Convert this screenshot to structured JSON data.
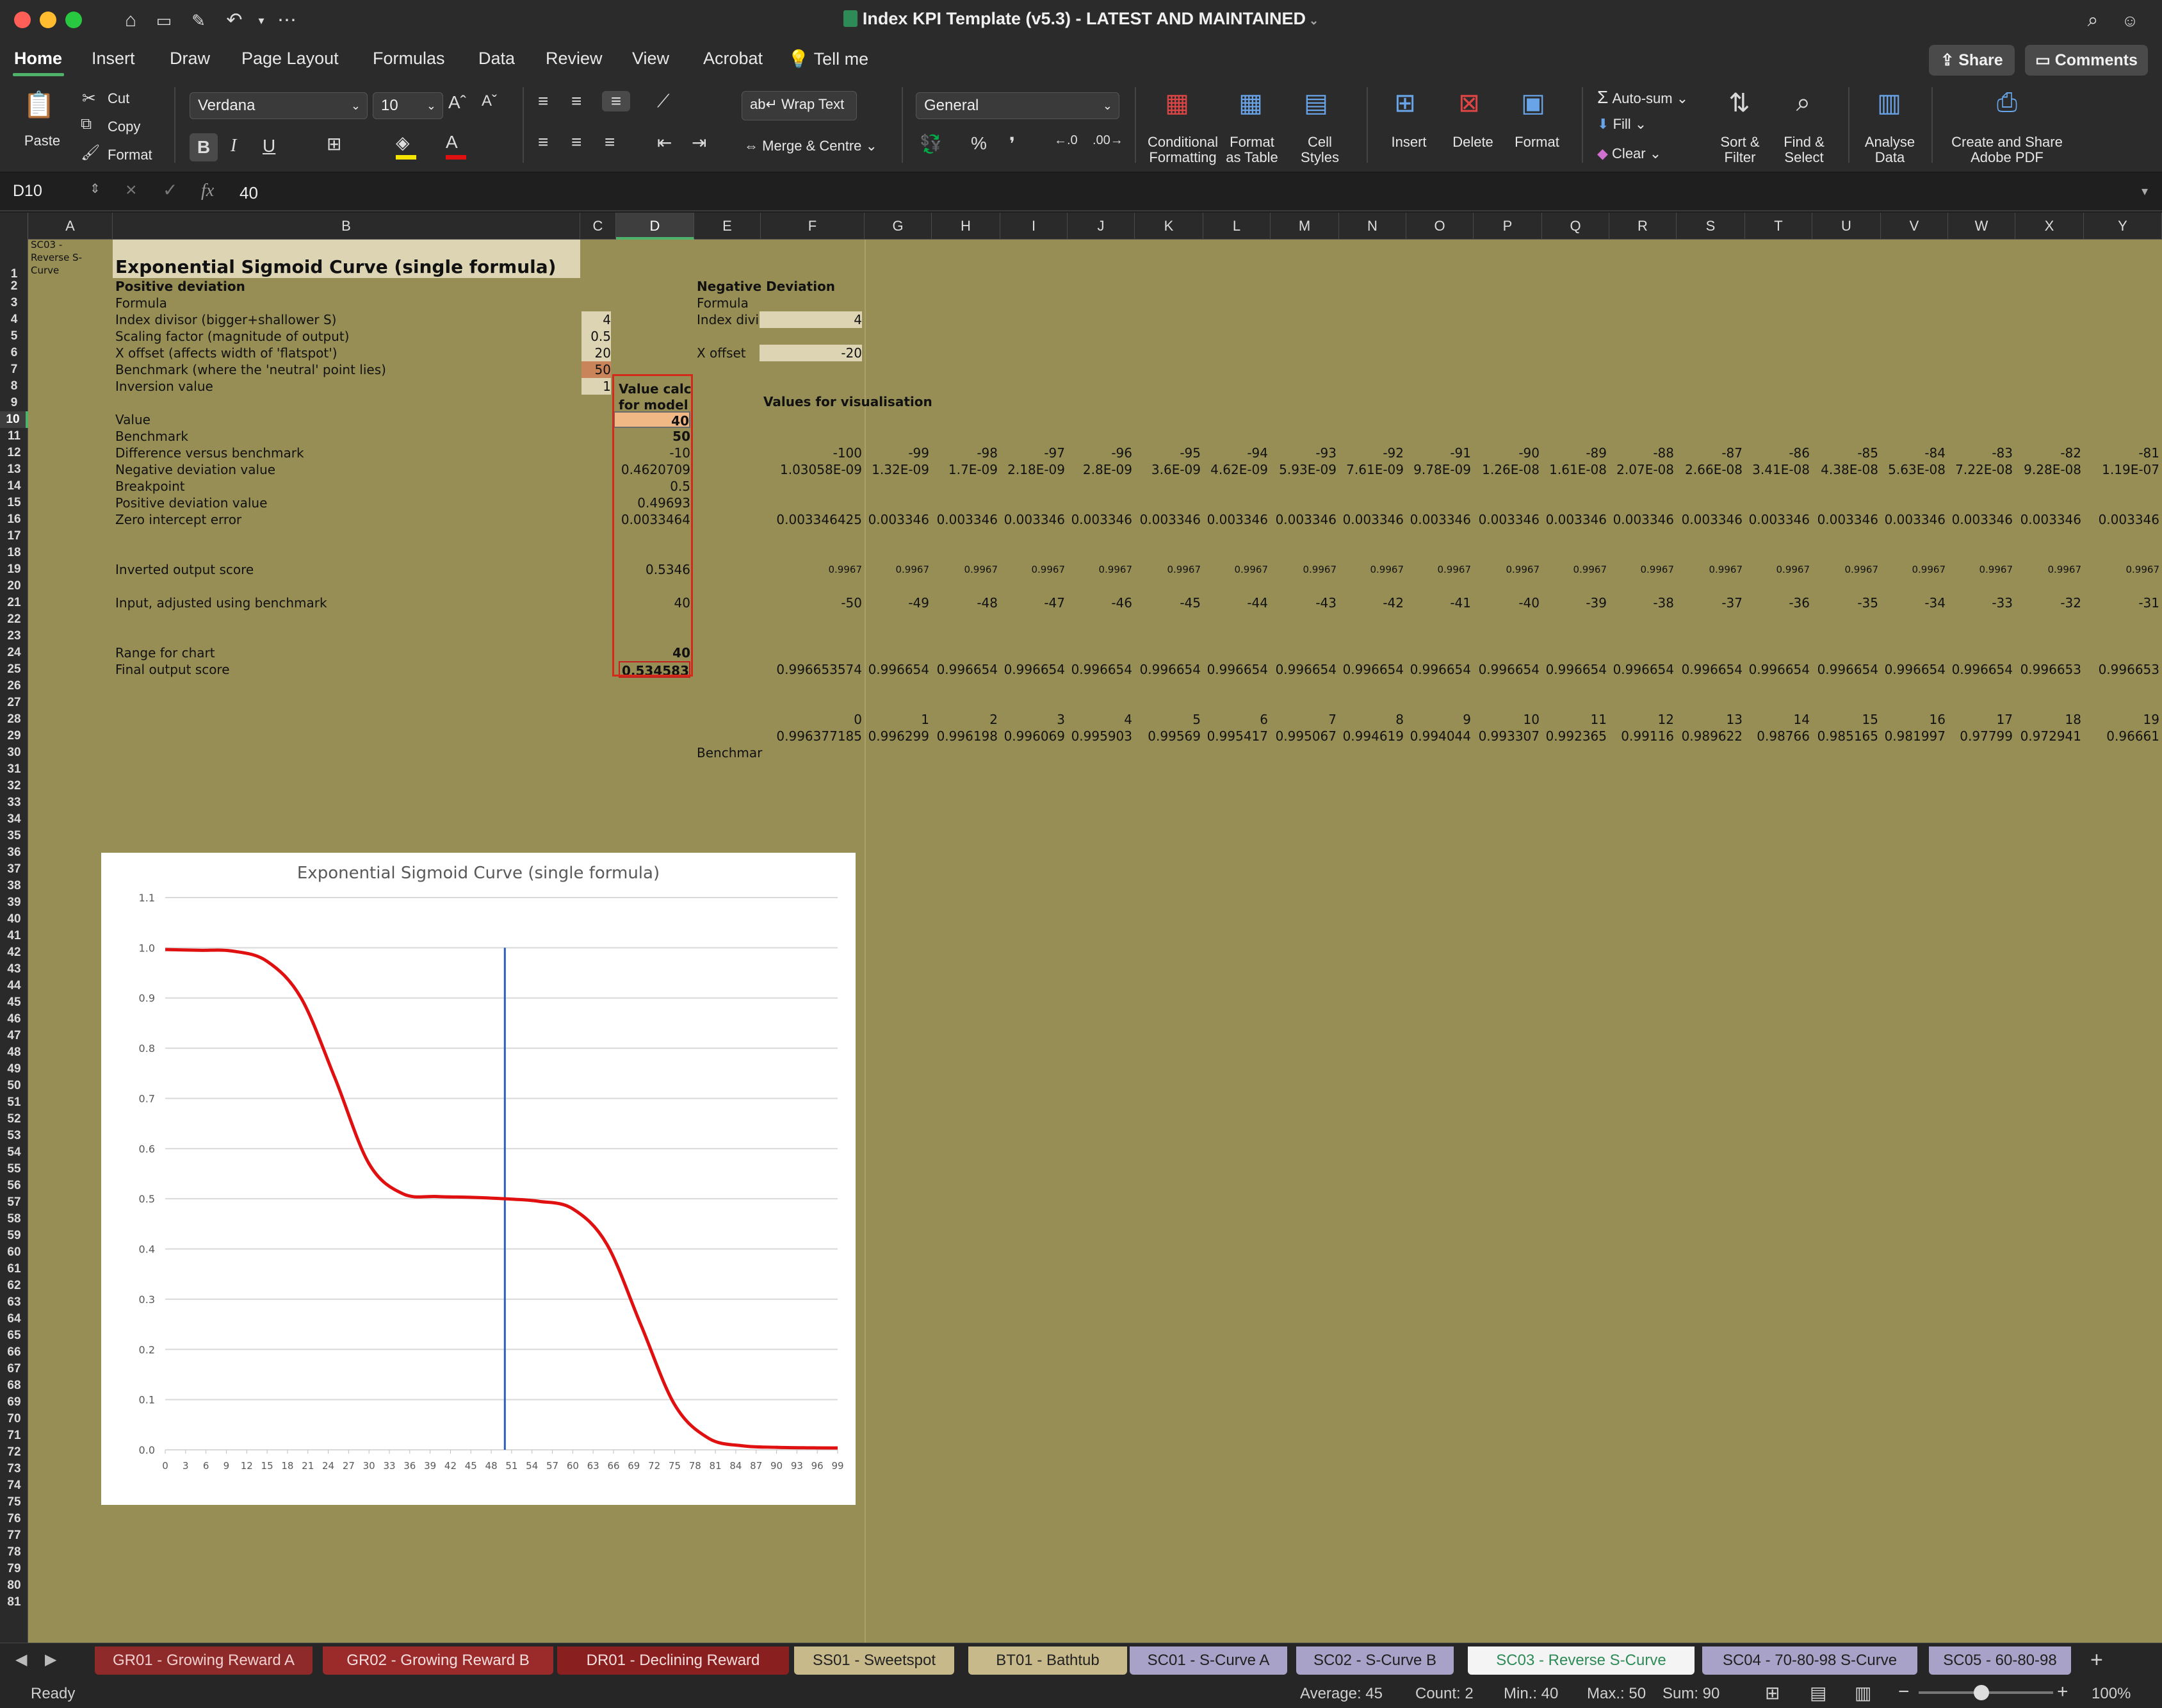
{
  "window": {
    "title": "Index KPI Template (v5.3) - LATEST AND MAINTAINED",
    "traffic_colors": [
      "#ff5f57",
      "#febc2e",
      "#28c840"
    ]
  },
  "menu": {
    "tabs": [
      "Home",
      "Insert",
      "Draw",
      "Page Layout",
      "Formulas",
      "Data",
      "Review",
      "View",
      "Acrobat"
    ],
    "tell_me": "Tell me",
    "share": "Share",
    "comments": "Comments"
  },
  "ribbon": {
    "paste": "Paste",
    "cut": "Cut",
    "copy": "Copy",
    "format_painter": "Format",
    "font_name": "Verdana",
    "font_size": "10",
    "wrap_text": "Wrap Text",
    "merge_centre": "Merge & Centre",
    "number_format": "General",
    "conditional_formatting": [
      "Conditional",
      "Formatting"
    ],
    "format_as_table": [
      "Format",
      "as Table"
    ],
    "cell_styles": [
      "Cell",
      "Styles"
    ],
    "insert": "Insert",
    "delete": "Delete",
    "format": "Format",
    "autosum": "Auto-sum",
    "fill": "Fill",
    "clear": "Clear",
    "sort_filter": [
      "Sort &",
      "Filter"
    ],
    "find_select": [
      "Find &",
      "Select"
    ],
    "analyse": [
      "Analyse",
      "Data"
    ],
    "adobe": [
      "Create and Share",
      "Adobe PDF"
    ]
  },
  "formula_bar": {
    "name_box": "D10",
    "fx": "fx",
    "value": "40"
  },
  "columns": [
    "A",
    "B",
    "C",
    "D",
    "E",
    "F",
    "G",
    "H",
    "I",
    "J",
    "K",
    "L",
    "M",
    "N",
    "O",
    "P",
    "Q",
    "R",
    "S",
    "T",
    "U",
    "V",
    "W",
    "X",
    "Y"
  ],
  "sheet": {
    "a1_note": [
      "SC03 -",
      "Reverse S-",
      "Curve"
    ],
    "title": "Exponential Sigmoid Curve (single formula)",
    "positive_header": "Positive deviation",
    "formula_label": "Formula",
    "params": [
      {
        "label": "Index divisor (bigger+shallower S)",
        "value": "4"
      },
      {
        "label": "Scaling factor (magnitude of output)",
        "value": "0.5"
      },
      {
        "label": "X offset (affects width of 'flatspot')",
        "value": "20"
      },
      {
        "label": "Benchmark (where the 'neutral' point lies)",
        "value": "50"
      },
      {
        "label": "Inversion value",
        "value": "1"
      }
    ],
    "negative_header": "Negative Deviation",
    "neg_formula": "Formula",
    "neg_index_label": "Index divi",
    "neg_index_value": "4",
    "neg_xoffset_label": "X offset",
    "neg_xoffset_value": "-20",
    "value_calc_header": [
      "Value calc",
      "for model"
    ],
    "vis_header": "Values for visualisation",
    "model": [
      {
        "label": "Value",
        "value": "40"
      },
      {
        "label": "Benchmark",
        "value": "50"
      },
      {
        "label": "Difference versus benchmark",
        "value": "-10"
      },
      {
        "label": "Negative deviation value",
        "value": "0.4620709"
      },
      {
        "label": "Breakpoint",
        "value": "0.5"
      },
      {
        "label": "Positive deviation value",
        "value": "0.49693"
      },
      {
        "label": "Zero intercept error",
        "value": "0.0033464"
      }
    ],
    "inverted_label": "Inverted output score",
    "inverted_value": "0.5346",
    "adjusted_label": "Input, adjusted using benchmark",
    "adjusted_value": "40",
    "range_label": "Range for chart",
    "range_value": "40",
    "final_label": "Final output score",
    "final_value": "0.534583",
    "benchmark_cut": "Benchmar",
    "row12": [
      "-100",
      "-99",
      "-98",
      "-97",
      "-96",
      "-95",
      "-94",
      "-93",
      "-92",
      "-91",
      "-90",
      "-89",
      "-88",
      "-87",
      "-86",
      "-85",
      "-84",
      "-83",
      "-82",
      "-81"
    ],
    "row13": [
      "1.03058E-09",
      "1.32E-09",
      "1.7E-09",
      "2.18E-09",
      "2.8E-09",
      "3.6E-09",
      "4.62E-09",
      "5.93E-09",
      "7.61E-09",
      "9.78E-09",
      "1.26E-08",
      "1.61E-08",
      "2.07E-08",
      "2.66E-08",
      "3.41E-08",
      "4.38E-08",
      "5.63E-08",
      "7.22E-08",
      "9.28E-08",
      "1.19E-07"
    ],
    "row16": [
      "0.003346425",
      "0.003346",
      "0.003346",
      "0.003346",
      "0.003346",
      "0.003346",
      "0.003346",
      "0.003346",
      "0.003346",
      "0.003346",
      "0.003346",
      "0.003346",
      "0.003346",
      "0.003346",
      "0.003346",
      "0.003346",
      "0.003346",
      "0.003346",
      "0.003346",
      "0.003346"
    ],
    "row19": [
      "0.9967",
      "0.9967",
      "0.9967",
      "0.9967",
      "0.9967",
      "0.9967",
      "0.9967",
      "0.9967",
      "0.9967",
      "0.9967",
      "0.9967",
      "0.9967",
      "0.9967",
      "0.9967",
      "0.9967",
      "0.9967",
      "0.9967",
      "0.9967",
      "0.9967",
      "0.9967"
    ],
    "row21": [
      "-50",
      "-49",
      "-48",
      "-47",
      "-46",
      "-45",
      "-44",
      "-43",
      "-42",
      "-41",
      "-40",
      "-39",
      "-38",
      "-37",
      "-36",
      "-35",
      "-34",
      "-33",
      "-32",
      "-31"
    ],
    "row25": [
      "0.996653574",
      "0.996654",
      "0.996654",
      "0.996654",
      "0.996654",
      "0.996654",
      "0.996654",
      "0.996654",
      "0.996654",
      "0.996654",
      "0.996654",
      "0.996654",
      "0.996654",
      "0.996654",
      "0.996654",
      "0.996654",
      "0.996654",
      "0.996654",
      "0.996653",
      "0.996653"
    ],
    "row28": [
      "0",
      "1",
      "2",
      "3",
      "4",
      "5",
      "6",
      "7",
      "8",
      "9",
      "10",
      "11",
      "12",
      "13",
      "14",
      "15",
      "16",
      "17",
      "18",
      "19"
    ],
    "row29": [
      "0.996377185",
      "0.996299",
      "0.996198",
      "0.996069",
      "0.995903",
      "0.99569",
      "0.995417",
      "0.995067",
      "0.994619",
      "0.994044",
      "0.993307",
      "0.992365",
      "0.99116",
      "0.989622",
      "0.98766",
      "0.985165",
      "0.981997",
      "0.97799",
      "0.972941",
      "0.96661"
    ]
  },
  "chart_data": {
    "type": "line",
    "title": "Exponential Sigmoid Curve (single formula)",
    "xlabel": "",
    "ylabel": "",
    "ylim": [
      0,
      1.1
    ],
    "yticks": [
      "0.0",
      "0.1",
      "0.2",
      "0.3",
      "0.4",
      "0.5",
      "0.6",
      "0.7",
      "0.8",
      "0.9",
      "1.0",
      "1.1"
    ],
    "xticks": [
      "0",
      "3",
      "6",
      "9",
      "12",
      "15",
      "18",
      "21",
      "24",
      "27",
      "30",
      "33",
      "36",
      "39",
      "42",
      "45",
      "48",
      "51",
      "54",
      "57",
      "60",
      "63",
      "66",
      "69",
      "72",
      "75",
      "78",
      "81",
      "84",
      "87",
      "90",
      "93",
      "96",
      "99"
    ],
    "x": [
      0,
      5,
      10,
      15,
      20,
      25,
      30,
      35,
      40,
      45,
      50,
      55,
      60,
      65,
      70,
      75,
      80,
      85,
      90,
      95,
      99
    ],
    "series": [
      {
        "values": [
          0.9964,
          0.995,
          0.9933,
          0.973,
          0.9,
          0.74,
          0.57,
          0.51,
          0.5046,
          0.503,
          0.5,
          0.495,
          0.48,
          0.41,
          0.25,
          0.09,
          0.023,
          0.008,
          0.005,
          0.004,
          0.0036
        ],
        "color": "#e01010"
      }
    ],
    "marker_line": {
      "x": 50,
      "y_from": 0,
      "y_to": 1.0,
      "color": "#2b5fb8"
    },
    "grid": true
  },
  "sheet_tabs": [
    {
      "label": "GR01 - Growing Reward A",
      "color": "#8e2a2a",
      "text": "#f2d0d0"
    },
    {
      "label": "GR02 - Growing Reward B",
      "color": "#9b2a2a",
      "text": "#f5dede"
    },
    {
      "label": "DR01 - Declining Reward",
      "color": "#8a1f1f",
      "text": "#f5dede"
    },
    {
      "label": "SS01 - Sweetspot",
      "color": "#c7b98a",
      "text": "#222222"
    },
    {
      "label": "BT01 - Bathtub",
      "color": "#c7b98a",
      "text": "#222222"
    },
    {
      "label": "SC01 - S-Curve A",
      "color": "#a9a2c8",
      "text": "#1f1f1f"
    },
    {
      "label": "SC02 - S-Curve B",
      "color": "#a9a2c8",
      "text": "#1f1f1f"
    },
    {
      "label": "SC03 - Reverse S-Curve",
      "color": "#f4f4f4",
      "text": "#2e8b57"
    },
    {
      "label": "SC04 - 70-80-98 S-Curve",
      "color": "#a9a2c8",
      "text": "#1f1f1f"
    },
    {
      "label": "SC05 - 60-80-98",
      "color": "#a9a2c8",
      "text": "#1f1f1f"
    }
  ],
  "status": {
    "ready": "Ready",
    "average": "Average: 45",
    "count": "Count: 2",
    "min": "Min.: 40",
    "max": "Max.: 50",
    "sum": "Sum: 90",
    "zoom": "100%"
  }
}
